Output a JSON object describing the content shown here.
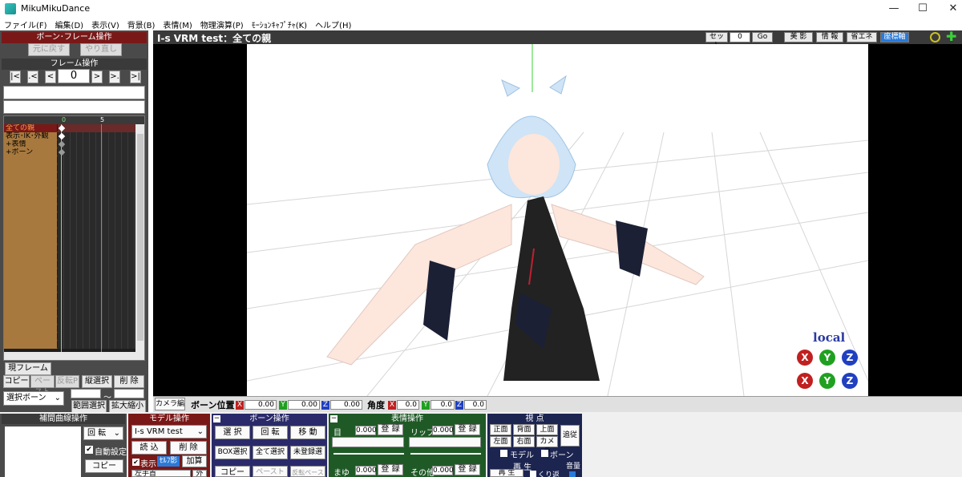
{
  "window": {
    "title": "MikuMikuDance",
    "minimize": "—",
    "maximize": "☐",
    "close": "✕"
  },
  "menu": [
    "ファイル(F)",
    "編集(D)",
    "表示(V)",
    "背景(B)",
    "表情(M)",
    "物理演算(P)",
    "ﾓｰｼｮﾝｷｬﾌﾟﾁｬ(K)",
    "ヘルプ(H)"
  ],
  "bone_frame": {
    "header": "ボーン･フレーム操作",
    "undo": "元に戻す",
    "redo": "やり直し"
  },
  "frame_ops": {
    "header": "フレーム操作",
    "first": "|<",
    "prev_key": ".<",
    "prev": "<",
    "frame_value": "0",
    "next": ">",
    "next_key": ">.",
    "last": ">|"
  },
  "timeline": {
    "ruler_0": "0",
    "ruler_5": "5",
    "rows": [
      "全ての親",
      "表示･IK･外観",
      "+表情",
      "+ボーン"
    ]
  },
  "left_bottom": {
    "current_frame": "現フレーム",
    "copy": "コピー",
    "paste": "ペースト",
    "reverse_paste": "反転P",
    "vertical_select": "縦選択",
    "delete": "削 除",
    "select_bone": "選択ボーン",
    "tilde": "～",
    "range_select": "範囲選択",
    "zoom": "拡大縮小"
  },
  "view": {
    "title": "I-s VRM test：全ての親",
    "set": "セット",
    "set_value": "0",
    "go": "Go",
    "beauty": "美 影",
    "info": "情 報",
    "eco": "省エネ",
    "axis": "座標軸",
    "local": "local"
  },
  "posbar": {
    "camera_edit": "カメラ編",
    "bone_pos": "ボーン位置",
    "x": "X",
    "y": "Y",
    "z": "Z",
    "pos_x": "0.00",
    "pos_y": "0.00",
    "pos_z": "0.00",
    "angle": "角度",
    "ang_x": "0.0",
    "ang_y": "0.0",
    "ang_z": "0.0"
  },
  "interp": {
    "header": "補間曲線操作",
    "rotate": "回 転",
    "auto": "自動設定",
    "copy": "コピー"
  },
  "model": {
    "header": "モデル操作",
    "selected": "I-s VRM test",
    "load": "読 込",
    "delete": "削 除",
    "show": "表示",
    "self_shadow": "ｾﾙﾌ影",
    "add": "加算",
    "left_wrist": "左手首",
    "outside": "外"
  },
  "bone_ops": {
    "header": "ボーン操作",
    "select": "選 択",
    "rotate": "回 転",
    "move": "移 動",
    "box_select": "BOX選択",
    "select_all": "全て選択",
    "unregistered": "未登録選",
    "copy": "コピー",
    "paste": "ペースト",
    "reverse_paste": "反転ペースト"
  },
  "morph_ops": {
    "header": "表情操作",
    "eye": "目",
    "eye_value": "0.000",
    "register": "登 録",
    "lip": "リップ",
    "lip_value": "0.000",
    "brow": "まゆ",
    "brow_value": "0.000",
    "other": "その他",
    "other_value": "0.000"
  },
  "viewpoint": {
    "header": "視 点",
    "front": "正面",
    "back": "背面",
    "top": "上面",
    "left": "左面",
    "right": "右面",
    "camera": "カメラ",
    "follow": "追従",
    "model": "モデル",
    "bone": "ボーン"
  },
  "playback": {
    "header": "再 生",
    "play": "再 生",
    "loop": "くり返",
    "volume": "音量"
  },
  "colors": {
    "red_panel": "#7a1818",
    "blue_panel": "#2a2a6a",
    "green_panel": "#1f5a26",
    "navy_panel": "#1c2450"
  }
}
